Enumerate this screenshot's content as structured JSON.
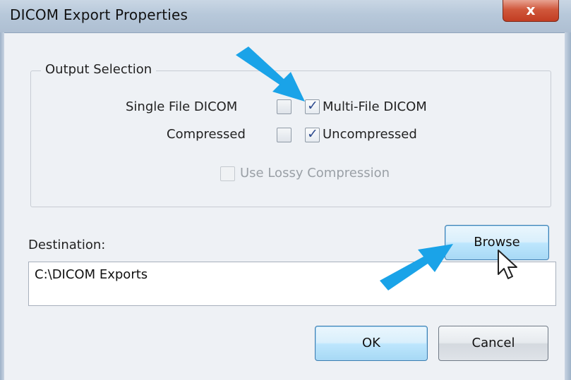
{
  "window": {
    "title": "DICOM Export Properties",
    "close_glyph": "x"
  },
  "output_selection": {
    "label": "Output Selection",
    "single_file": {
      "label": "Single File DICOM",
      "checked": false
    },
    "multi_file": {
      "label": "Multi-File DICOM",
      "checked": true
    },
    "compressed": {
      "label": "Compressed",
      "checked": false
    },
    "uncompressed": {
      "label": "Uncompressed",
      "checked": true
    },
    "lossy": {
      "label": "Use Lossy Compression",
      "checked": false,
      "enabled": false
    }
  },
  "destination": {
    "label": "Destination:",
    "value": "C:\\DICOM Exports",
    "browse_label": "Browse"
  },
  "buttons": {
    "ok": "OK",
    "cancel": "Cancel"
  },
  "colors": {
    "annotation_arrow": "#1aa3e8",
    "check_mark": "#2c4a8e"
  },
  "icons": {
    "check": "✓",
    "cursor": "mouse-pointer-icon",
    "arrow": "annotation-arrow-icon"
  }
}
